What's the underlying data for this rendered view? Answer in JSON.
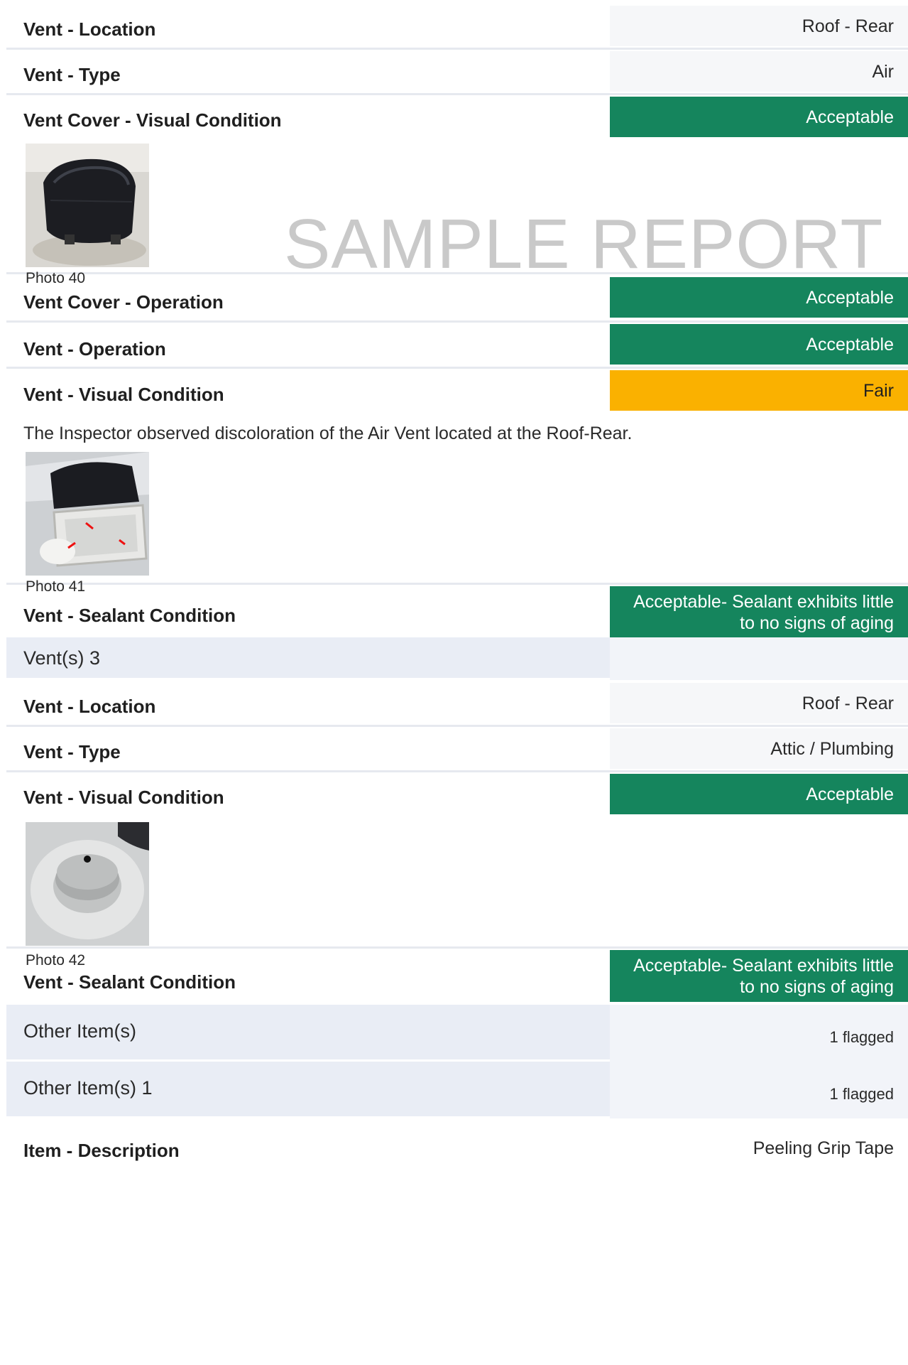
{
  "watermark": "SAMPLE REPORT",
  "rows": {
    "r1": {
      "label": "Vent - Location",
      "value": "Roof - Rear"
    },
    "r2": {
      "label": "Vent - Type",
      "value": "Air"
    },
    "r3": {
      "label": "Vent Cover - Visual Condition",
      "value": "Acceptable"
    },
    "photo40": "Photo 40",
    "r4": {
      "label": "Vent Cover - Operation",
      "value": "Acceptable"
    },
    "r5": {
      "label": "Vent - Operation",
      "value": "Acceptable"
    },
    "r6": {
      "label": "Vent - Visual Condition",
      "value": "Fair"
    },
    "comment6": "The Inspector observed discoloration of the Air Vent located at the Roof-Rear.",
    "photo41": "Photo 41",
    "r7": {
      "label": "Vent - Sealant Condition",
      "value_line1": "Acceptable- Sealant exhibits little",
      "value_line2": "to no signs of aging"
    },
    "s1": {
      "label": "Vent(s) 3",
      "value": ""
    },
    "r8": {
      "label": "Vent - Location",
      "value": "Roof - Rear"
    },
    "r9": {
      "label": "Vent - Type",
      "value": "Attic / Plumbing"
    },
    "r10": {
      "label": "Vent - Visual Condition",
      "value": "Acceptable"
    },
    "photo42": "Photo 42",
    "r11": {
      "label": "Vent - Sealant Condition",
      "value_line1": "Acceptable- Sealant exhibits little",
      "value_line2": "to no signs of aging"
    },
    "s2": {
      "label": "Other Item(s)",
      "value": "1 flagged"
    },
    "s3": {
      "label": "Other Item(s) 1",
      "value": "1 flagged"
    },
    "r12": {
      "label": "Item - Description",
      "value": "Peeling Grip Tape"
    }
  },
  "colors": {
    "acceptable": "#15855d",
    "fair": "#fab100",
    "section": "#e9edf5"
  }
}
